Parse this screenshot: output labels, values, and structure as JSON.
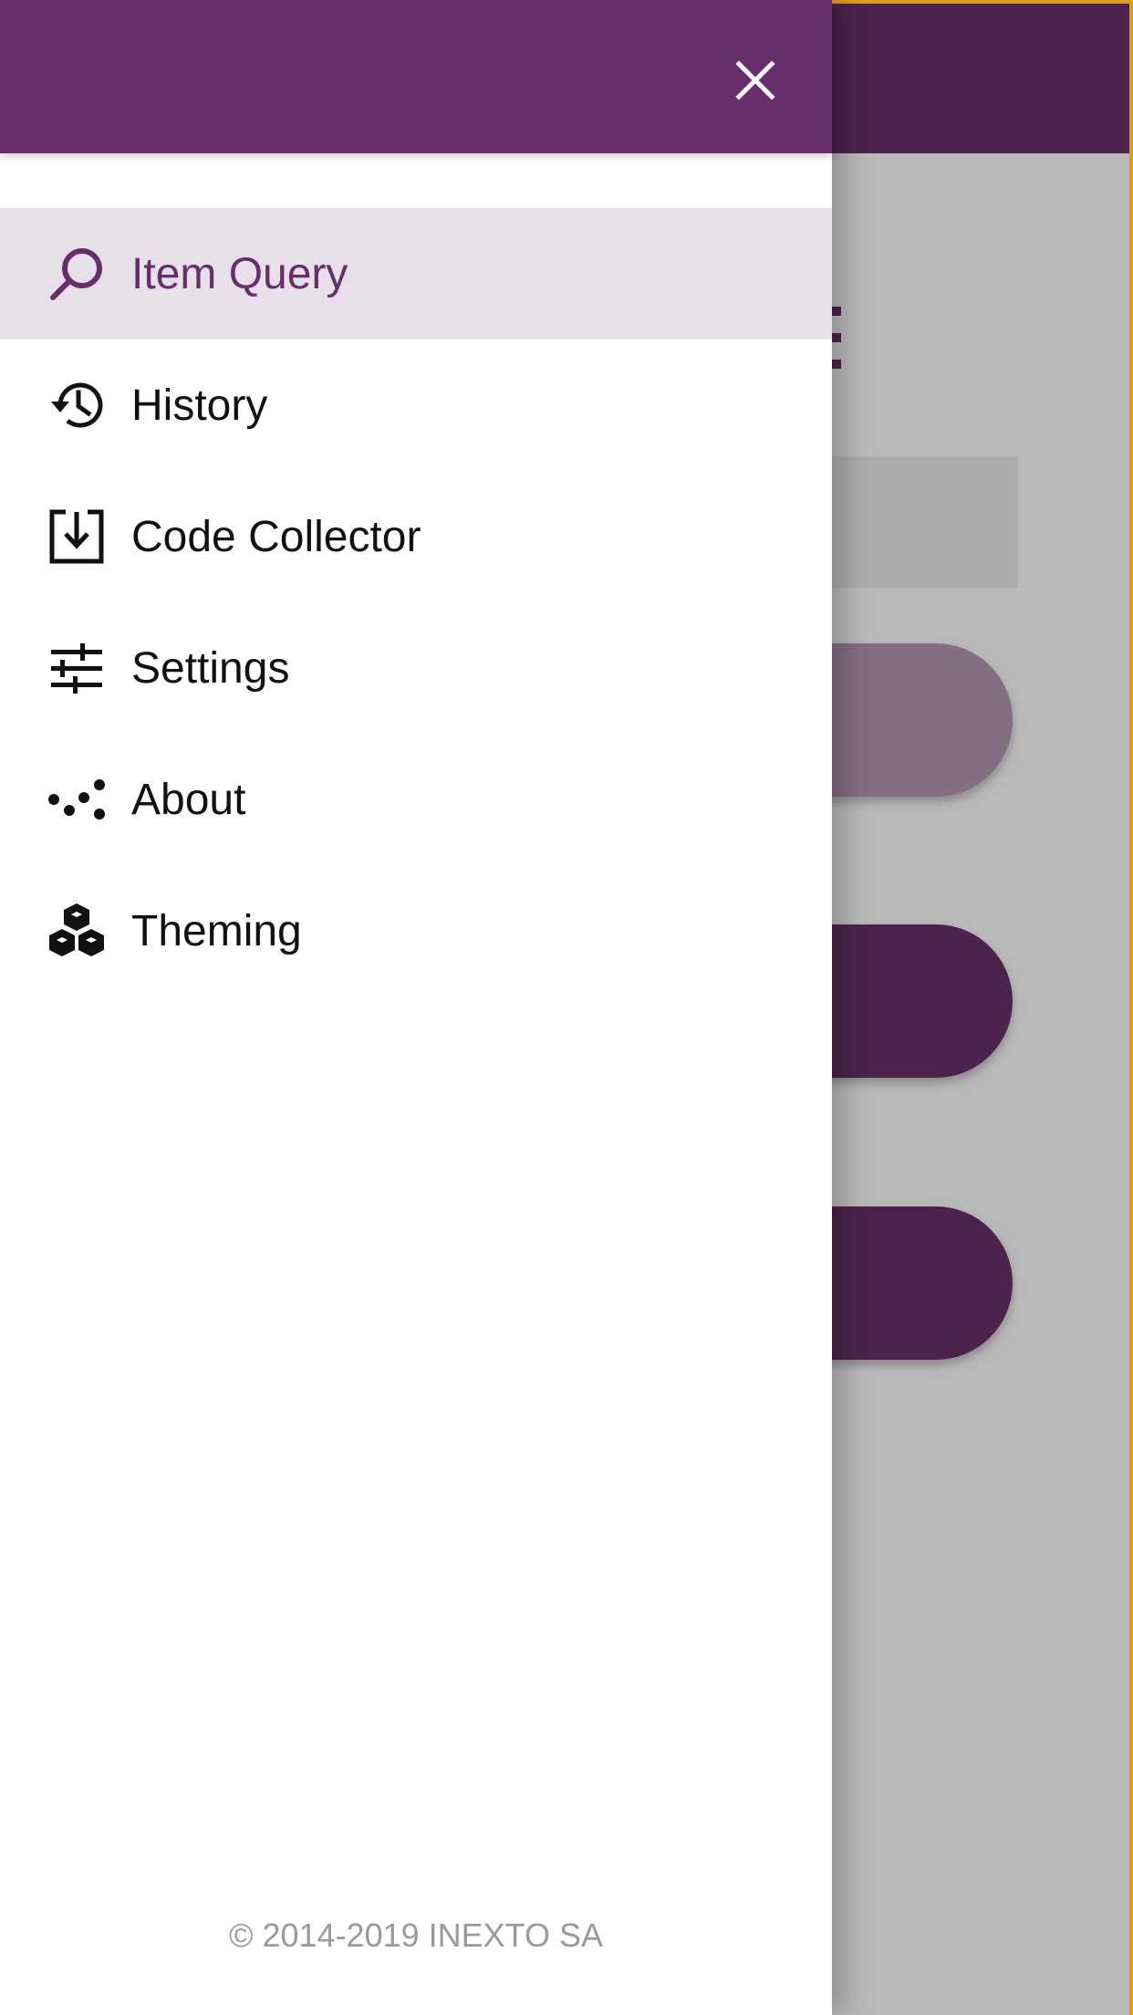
{
  "colors": {
    "header": "#672e6b",
    "active_bg": "#e8e0e9",
    "active_text": "#672e6b",
    "text": "#111111",
    "footer_text": "#9a9a9a"
  },
  "drawer": {
    "close_icon": "close-icon",
    "items": [
      {
        "label": "Item Query",
        "icon": "search-icon",
        "active": true
      },
      {
        "label": "History",
        "icon": "history-icon",
        "active": false
      },
      {
        "label": "Code Collector",
        "icon": "download-box-icon",
        "active": false
      },
      {
        "label": "Settings",
        "icon": "sliders-icon",
        "active": false
      },
      {
        "label": "About",
        "icon": "dots-icon",
        "active": false
      },
      {
        "label": "Theming",
        "icon": "cubes-icon",
        "active": false
      }
    ],
    "footer": "© 2014-2019 INEXTO SA"
  }
}
